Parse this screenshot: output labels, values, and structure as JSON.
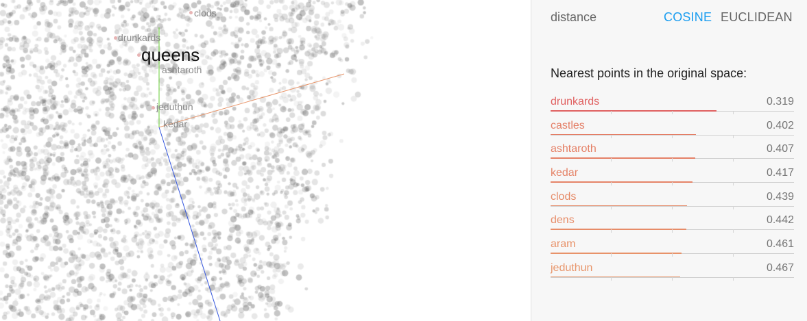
{
  "projector": {
    "focus_label": "queens",
    "labels": [
      "clods",
      "drunkards",
      "ashtaroth",
      "jeduthun",
      "kedar"
    ]
  },
  "panel": {
    "distance_label": "distance",
    "metric_cosine": "COSINE",
    "metric_euclidean": "EUCLIDEAN",
    "active_metric": "COSINE",
    "nearest_title": "Nearest points in the original space:",
    "nearest": [
      {
        "name": "drunkards",
        "value": "0.319"
      },
      {
        "name": "castles",
        "value": "0.402"
      },
      {
        "name": "ashtaroth",
        "value": "0.407"
      },
      {
        "name": "kedar",
        "value": "0.417"
      },
      {
        "name": "clods",
        "value": "0.439"
      },
      {
        "name": "dens",
        "value": "0.442"
      },
      {
        "name": "aram",
        "value": "0.461"
      },
      {
        "name": "jeduthun",
        "value": "0.467"
      }
    ]
  },
  "colors": {
    "accent": "#1a9df0",
    "near_color": "#e06060",
    "far_color": "#e8956a",
    "axis_x": "#e8956a",
    "axis_y": "#66cc33",
    "axis_z": "#3355dd"
  }
}
